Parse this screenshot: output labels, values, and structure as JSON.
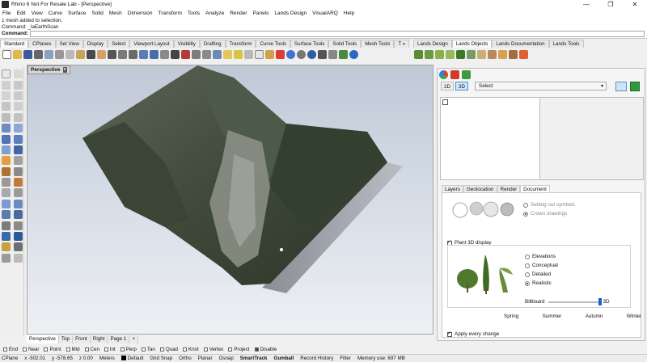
{
  "window": {
    "title": "Rhino 6 Not For Resale Lab - [Perspective]",
    "controls": [
      "—",
      "❐",
      "✕"
    ]
  },
  "menu": [
    "File",
    "Edit",
    "View",
    "Curve",
    "Surface",
    "Solid",
    "Mesh",
    "Dimension",
    "Transform",
    "Tools",
    "Analyze",
    "Render",
    "Panels",
    "Lands Design",
    "VisualARQ",
    "Help"
  ],
  "command": {
    "history": [
      "1 mesh added to selection.",
      "Command: _laEarthScan"
    ],
    "prompt_label": "Command:"
  },
  "toolbar_tabs": [
    "Standard",
    "CPlanes",
    "Set View",
    "Display",
    "Select",
    "Viewport Layout",
    "Visibility",
    "Drafting",
    "Transform",
    "Curve Tools",
    "Surface Tools",
    "Solid Tools",
    "Mesh Tools",
    "T »"
  ],
  "right_toolbar_tabs": [
    "Lands Design",
    "Lands Objects",
    "Lands Documentation",
    "Lands Tools"
  ],
  "viewport": {
    "label": "Perspective"
  },
  "viewport_tabs": [
    "Perspective",
    "Top",
    "Front",
    "Right",
    "Page 1",
    "+"
  ],
  "osnaps": [
    {
      "label": "End",
      "on": false
    },
    {
      "label": "Near",
      "on": false
    },
    {
      "label": "Point",
      "on": false
    },
    {
      "label": "Mid",
      "on": false
    },
    {
      "label": "Cen",
      "on": false
    },
    {
      "label": "Int",
      "on": false
    },
    {
      "label": "Perp",
      "on": false
    },
    {
      "label": "Tan",
      "on": false
    },
    {
      "label": "Quad",
      "on": false
    },
    {
      "label": "Knot",
      "on": false
    },
    {
      "label": "Vertex",
      "on": false
    },
    {
      "label": "Project",
      "on": false
    },
    {
      "label": "Disable",
      "on": true
    }
  ],
  "status": {
    "cplane": "CPlane",
    "x": "x -502.01",
    "y": "y -578.65",
    "z": "z 0.00",
    "units": "Meters",
    "layer": "Default",
    "toggles": [
      "Grid Snap",
      "Ortho",
      "Planar",
      "Osnap",
      "SmartTrack",
      "Gumball",
      "Record History",
      "Filter"
    ],
    "bold_toggles": [
      "SmartTrack",
      "Gumball"
    ],
    "memory": "Memory use: 697 MB"
  },
  "panel": {
    "mode_2d": "2D",
    "mode_3d": "3D",
    "select_value": "Select",
    "subtabs": [
      "Layers",
      "Geolocation",
      "Render",
      "Document"
    ],
    "symbol_options": [
      "Setting out symbols",
      "Crown drawings"
    ],
    "plant3d_label": "Plant 3D display",
    "plant3d_options": [
      {
        "label": "Elevations",
        "on": false
      },
      {
        "label": "Conceptual",
        "on": false
      },
      {
        "label": "Detailed",
        "on": false
      },
      {
        "label": "Realistic",
        "on": true
      }
    ],
    "slider_left": "Billboard",
    "slider_right": "3D",
    "slider_value": 1.0,
    "seasons": [
      "Spring",
      "Summer",
      "Autumn",
      "Winter"
    ],
    "apply_label": "Apply every change"
  },
  "colors": {
    "accent": "#1a62c5",
    "green": "#2e9a3a"
  }
}
